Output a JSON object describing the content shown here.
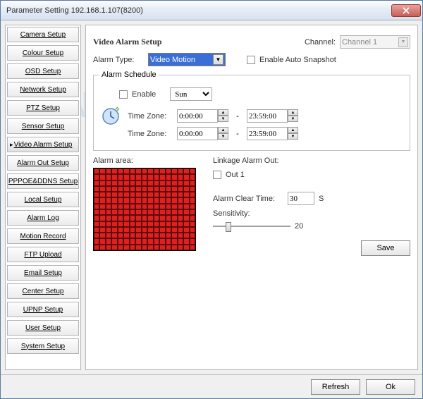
{
  "window": {
    "title": "Parameter Setting 192.168.1.107(8200)"
  },
  "sidebar": {
    "items": [
      "Camera Setup",
      "Colour Setup",
      "OSD Setup",
      "Network Setup",
      "PTZ Setup",
      "Sensor Setup",
      "Video Alarm Setup",
      "Alarm Out Setup",
      "PPPOE&DDNS Setup",
      "Local Setup",
      "Alarm Log",
      "Motion Record",
      "FTP Upload",
      "Email Setup",
      "Center Setup",
      "UPNP Setup",
      "User Setup",
      "System Setup"
    ],
    "selected_index": 6
  },
  "main": {
    "title": "Video Alarm Setup",
    "channel_label": "Channel:",
    "channel_value": "Channel 1",
    "alarm_type_label": "Alarm Type:",
    "alarm_type_value": "Video Motion",
    "enable_snapshot_label": "Enable Auto Snapshot",
    "schedule": {
      "legend": "Alarm Schedule",
      "enable_label": "Enable",
      "day_value": "Sun",
      "tz_label": "Time Zone:",
      "tz1_start": "0:00:00",
      "tz1_end": "23:59:00",
      "tz2_start": "0:00:00",
      "tz2_end": "23:59:00",
      "sep": "-"
    },
    "alarm_area_label": "Alarm area:",
    "linkage_label": "Linkage Alarm Out:",
    "out1_label": "Out 1",
    "clear_time_label": "Alarm Clear Time:",
    "clear_time_value": "30",
    "clear_time_unit": "S",
    "sensitivity_label": "Sensitivity:",
    "sensitivity_value": "20",
    "save_label": "Save"
  },
  "footer": {
    "refresh": "Refresh",
    "ok": "Ok"
  }
}
